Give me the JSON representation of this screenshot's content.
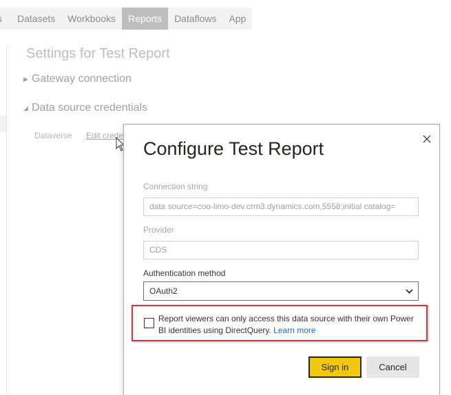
{
  "tabs": [
    {
      "label": "s",
      "active": false
    },
    {
      "label": "Datasets",
      "active": false
    },
    {
      "label": "Workbooks",
      "active": false
    },
    {
      "label": "Reports",
      "active": true
    },
    {
      "label": "Dataflows",
      "active": false
    },
    {
      "label": "App",
      "active": false
    }
  ],
  "settings": {
    "title": "Settings for Test Report",
    "gateway_section": "Gateway connection",
    "datasource_section": "Data source credentials",
    "datasource_name": "Dataverse",
    "edit_credentials": "Edit credentials"
  },
  "dialog": {
    "title": "Configure Test Report",
    "connection_string_label": "Connection string",
    "connection_string_value": "data source=coo-limo-dev.crm3.dynamics.com,5558;initial catalog=",
    "provider_label": "Provider",
    "provider_value": "CDS",
    "auth_label": "Authentication method",
    "auth_value": "OAuth2",
    "checkbox_text": "Report viewers can only access this data source with their own Power BI identities using DirectQuery.",
    "learn_more": "Learn more",
    "signin_label": "Sign in",
    "cancel_label": "Cancel"
  },
  "colors": {
    "accent": "#f2c811",
    "highlight_border": "#d4333a",
    "link": "#1f6bb5",
    "active_tab": "#bdbdbd"
  },
  "icons": {
    "close": "close-icon",
    "cursor": "mouse-pointer-icon",
    "expand_collapsed": "triangle-right-icon",
    "expand_open": "triangle-down-icon",
    "select": "chevron-down-icon"
  }
}
